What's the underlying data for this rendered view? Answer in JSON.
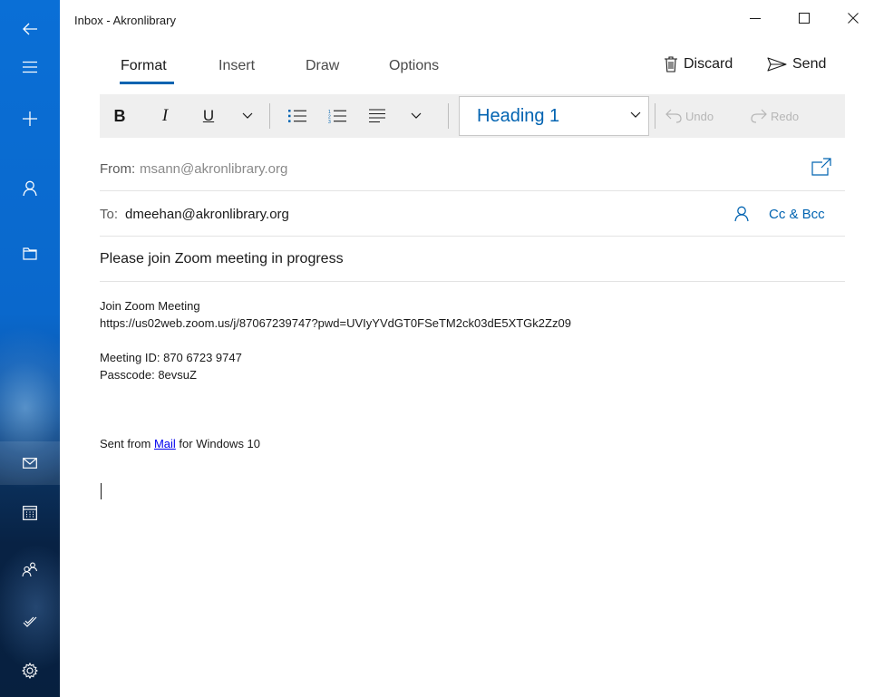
{
  "window": {
    "title": "Inbox - Akronlibrary"
  },
  "tabs": [
    {
      "label": "Format",
      "active": true
    },
    {
      "label": "Insert",
      "active": false
    },
    {
      "label": "Draw",
      "active": false
    },
    {
      "label": "Options",
      "active": false
    }
  ],
  "actions": {
    "discard_label": "Discard",
    "send_label": "Send"
  },
  "format_bar": {
    "bold": "B",
    "italic": "I",
    "underline": "U",
    "style_value": "Heading 1",
    "undo_label": "Undo",
    "redo_label": "Redo"
  },
  "compose": {
    "from_label": "From:",
    "from_value": "msann@akronlibrary.org",
    "to_label": "To:",
    "to_value": "dmeehan@akronlibrary.org",
    "cc_bcc_label": "Cc & Bcc",
    "subject": "Please join Zoom meeting in progress"
  },
  "body": {
    "line1": "Join Zoom Meeting",
    "line2": "https://us02web.zoom.us/j/87067239747?pwd=UVIyYVdGT0FSeTM2ck03dE5XTGk2Zz09",
    "line3": "Meeting ID: 870 6723 9747",
    "line4": "Passcode: 8evsuZ",
    "signature_prefix": "Sent from ",
    "signature_link": "Mail",
    "signature_suffix": " for Windows 10"
  },
  "colors": {
    "accent": "#0063b1",
    "rail_top": "#0a6fd6",
    "rail_bottom": "#07203f",
    "toolbar_bg": "#efefef",
    "link": "#0000ee"
  },
  "icons": {
    "rail": [
      "back-arrow-icon",
      "hamburger-menu-icon",
      "new-mail-plus-icon",
      "account-person-icon",
      "folder-icon",
      "mail-envelope-icon",
      "calendar-icon",
      "people-icon",
      "todo-check-icon",
      "settings-gear-icon"
    ],
    "toolbar": [
      "trash-icon",
      "send-arrow-icon",
      "bullets-list-icon",
      "numbered-list-icon",
      "align-paragraph-icon",
      "undo-icon",
      "redo-icon",
      "popout-icon",
      "contact-person-icon"
    ]
  }
}
